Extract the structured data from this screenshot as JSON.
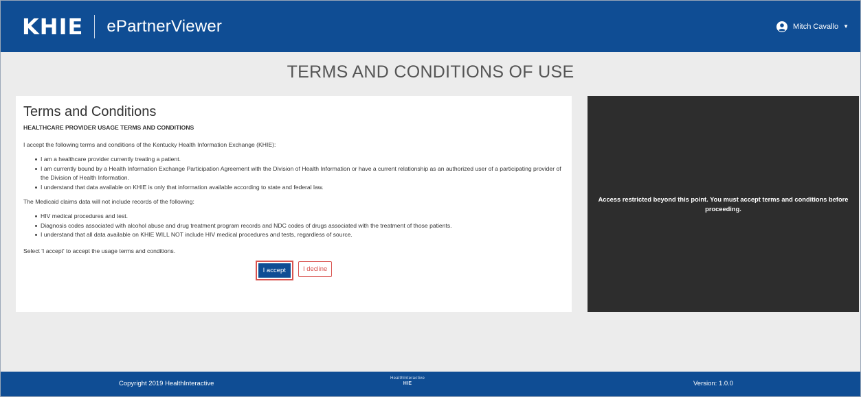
{
  "header": {
    "logo": "KHIE",
    "app_name": "ePartnerViewer",
    "user_name": "Mitch Cavallo",
    "user_icon": "user-circle-icon",
    "caret_icon": "caret-down-icon"
  },
  "page_title": "TERMS AND CONDITIONS OF USE",
  "terms": {
    "heading": "Terms and Conditions",
    "subheading": "HEALTHCARE PROVIDER USAGE TERMS AND CONDITIONS",
    "intro": "I accept the following terms and conditions of the Kentucky Health Information Exchange (KHIE):",
    "items": [
      "I am a healthcare provider currently treating a patient.",
      "I am currently bound by a Health Information Exchange Participation Agreement with the Division of Health Information or have a current relationship as an authorized user of a participating provider of the Division of Health Information.",
      "I understand that data available on KHIE is only that information available according to state and federal law."
    ],
    "medicaid_intro": "The Medicaid claims data will not include records of the following:",
    "medicaid_items": [
      "HIV medical procedures and test.",
      "Diagnosis codes associated with alcohol abuse and drug treatment program records and NDC codes of drugs associated with the treatment of those patients.",
      "I understand that all data available on KHIE WILL NOT include HIV medical procedures and tests, regardless of source."
    ],
    "select_note": "Select 'I accept' to accept the usage terms and conditions.",
    "accept_label": "I accept",
    "decline_label": "I decline"
  },
  "restricted_message": "Access restricted beyond this point. You must accept terms and conditions before proceeding.",
  "footer": {
    "copyright": "Copyright 2019 HealthInteractive",
    "logo_text": "HealthInteractive",
    "logo_sub": "HIE",
    "version": "Version: 1.0.0"
  },
  "colors": {
    "brand_blue": "#0f4d94",
    "decline_red": "#d9534f",
    "restricted_bg": "#2d2d2d"
  }
}
